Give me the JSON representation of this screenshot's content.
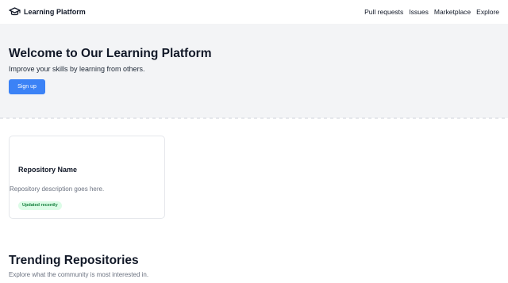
{
  "nav": {
    "brand": "Learning Platform",
    "brand_icon": "graduation-cap-icon",
    "links": [
      "Pull requests",
      "Issues",
      "Marketplace",
      "Explore"
    ]
  },
  "hero": {
    "title": "Welcome to Our Learning Platform",
    "subtitle": "Improve your skills by learning from others.",
    "signup_label": "Sign up"
  },
  "repo_card": {
    "name": "Repository Name",
    "description": "Repository description goes here.",
    "badge": "Updated recently"
  },
  "trending": {
    "title": "Trending Repositories",
    "subtitle": "Explore what the community is most interested in."
  },
  "colors": {
    "accent": "#3b82f6",
    "hero_bg": "#f3f4f6",
    "badge_bg": "#dcfce7",
    "badge_text": "#15803d"
  }
}
